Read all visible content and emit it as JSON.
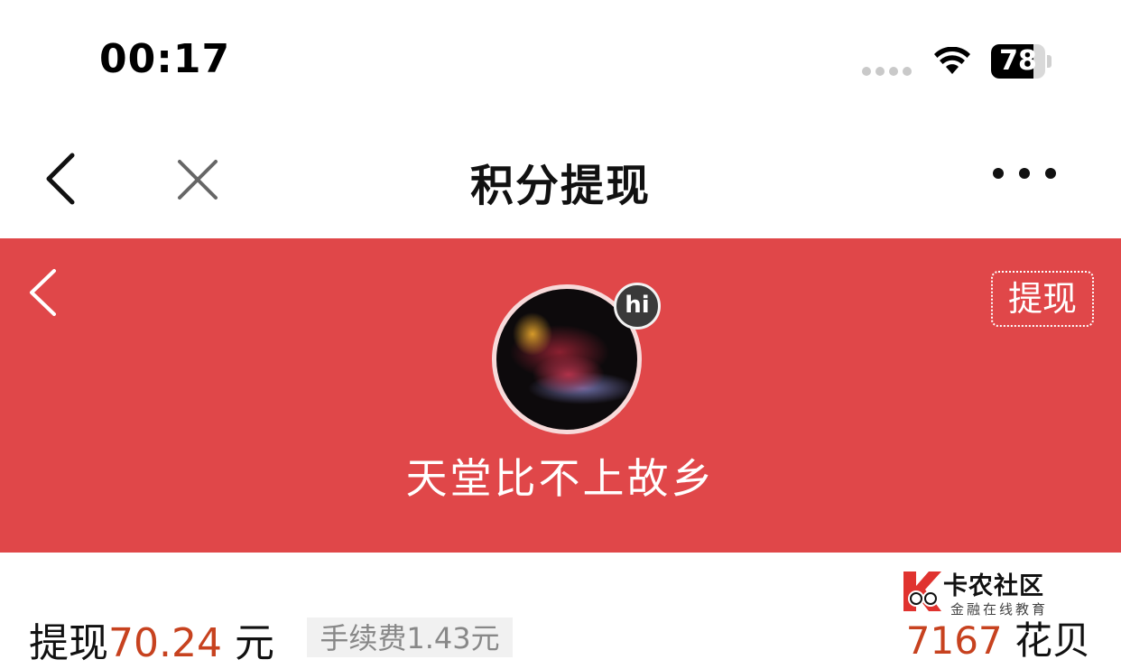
{
  "status_bar": {
    "time": "00:17",
    "battery_level": "78",
    "battery_fraction": 0.78,
    "icons": [
      "signal-dots-icon",
      "wifi-icon",
      "battery-icon"
    ]
  },
  "nav": {
    "title": "积分提现",
    "icons": [
      "chevron-left-icon",
      "close-icon",
      "more-icon"
    ]
  },
  "header": {
    "background_color": "#e04749",
    "withdraw_button": "提现",
    "badge": "hi",
    "username": "天堂比不上故乡"
  },
  "withdraw": {
    "label": "提现",
    "amount": "70.24",
    "unit": " 元",
    "fee": "手续费1.43元"
  },
  "points": {
    "value": "7167",
    "unit": " 花贝"
  },
  "watermark": {
    "name": "卡农社区",
    "tagline": "金融在线教育"
  },
  "colors": {
    "accent_red": "#e04749",
    "amount_orange": "#c7421f"
  }
}
